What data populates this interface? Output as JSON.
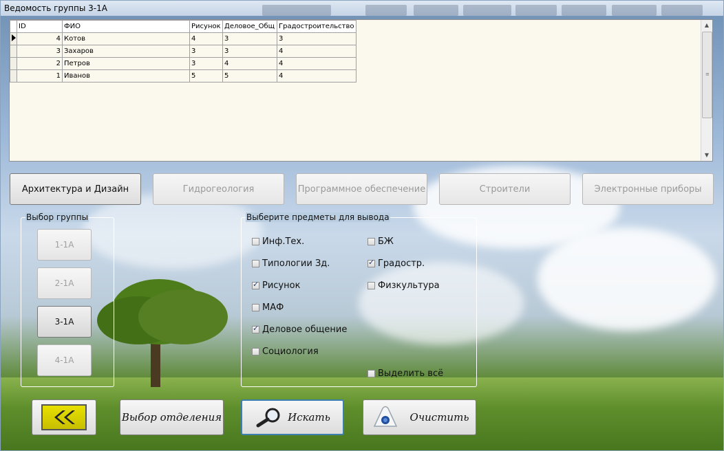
{
  "window": {
    "title": "Ведомость группы 3-1А"
  },
  "grid": {
    "columns": [
      "ID",
      "ФИО",
      "Рисунок",
      "Деловое_Общ",
      "Градостроительство"
    ],
    "rows": [
      {
        "id": "4",
        "fio": "Котов",
        "ris": "4",
        "del": "3",
        "gra": "3",
        "current": true
      },
      {
        "id": "3",
        "fio": "Захаров",
        "ris": "3",
        "del": "3",
        "gra": "4",
        "current": false
      },
      {
        "id": "2",
        "fio": "Петров",
        "ris": "3",
        "del": "4",
        "gra": "4",
        "current": false
      },
      {
        "id": "1",
        "fio": "Иванов",
        "ris": "5",
        "del": "5",
        "gra": "4",
        "current": false
      }
    ]
  },
  "departments": [
    {
      "label": "Архитектура и Дизайн",
      "enabled": true
    },
    {
      "label": "Гидрогеология",
      "enabled": false
    },
    {
      "label": "Программное обеспечение",
      "enabled": false
    },
    {
      "label": "Строители",
      "enabled": false
    },
    {
      "label": "Электронные приборы",
      "enabled": false
    }
  ],
  "group_box": {
    "legend": "Выбор группы",
    "groups": [
      {
        "label": "1-1А",
        "enabled": false
      },
      {
        "label": "2-1А",
        "enabled": false
      },
      {
        "label": "3-1А",
        "enabled": true
      },
      {
        "label": "4-1А",
        "enabled": false
      }
    ]
  },
  "subjects_box": {
    "legend": "Выберите предметы для вывода",
    "items": [
      {
        "label": "Инф.Тех.",
        "checked": false
      },
      {
        "label": "Типологии Зд.",
        "checked": false
      },
      {
        "label": "Рисунок",
        "checked": true
      },
      {
        "label": "МАФ",
        "checked": false
      },
      {
        "label": "Деловое общение",
        "checked": true
      },
      {
        "label": "Социология",
        "checked": false
      },
      {
        "label": "БЖ",
        "checked": false
      },
      {
        "label": "Градостр.",
        "checked": true
      },
      {
        "label": "Физкультура",
        "checked": false
      },
      {
        "label": "Выделить всё",
        "checked": false
      }
    ]
  },
  "bottom_buttons": {
    "back_icon": "double-chevron-left-icon",
    "choose_dept": "Выбор отделения",
    "search": "Искать",
    "search_icon": "magnifier-icon",
    "clear": "Очистить",
    "clear_icon": "eraser-icon"
  },
  "colors": {
    "accent_focus": "#3c7fb1",
    "back_button": "#e8e000"
  }
}
